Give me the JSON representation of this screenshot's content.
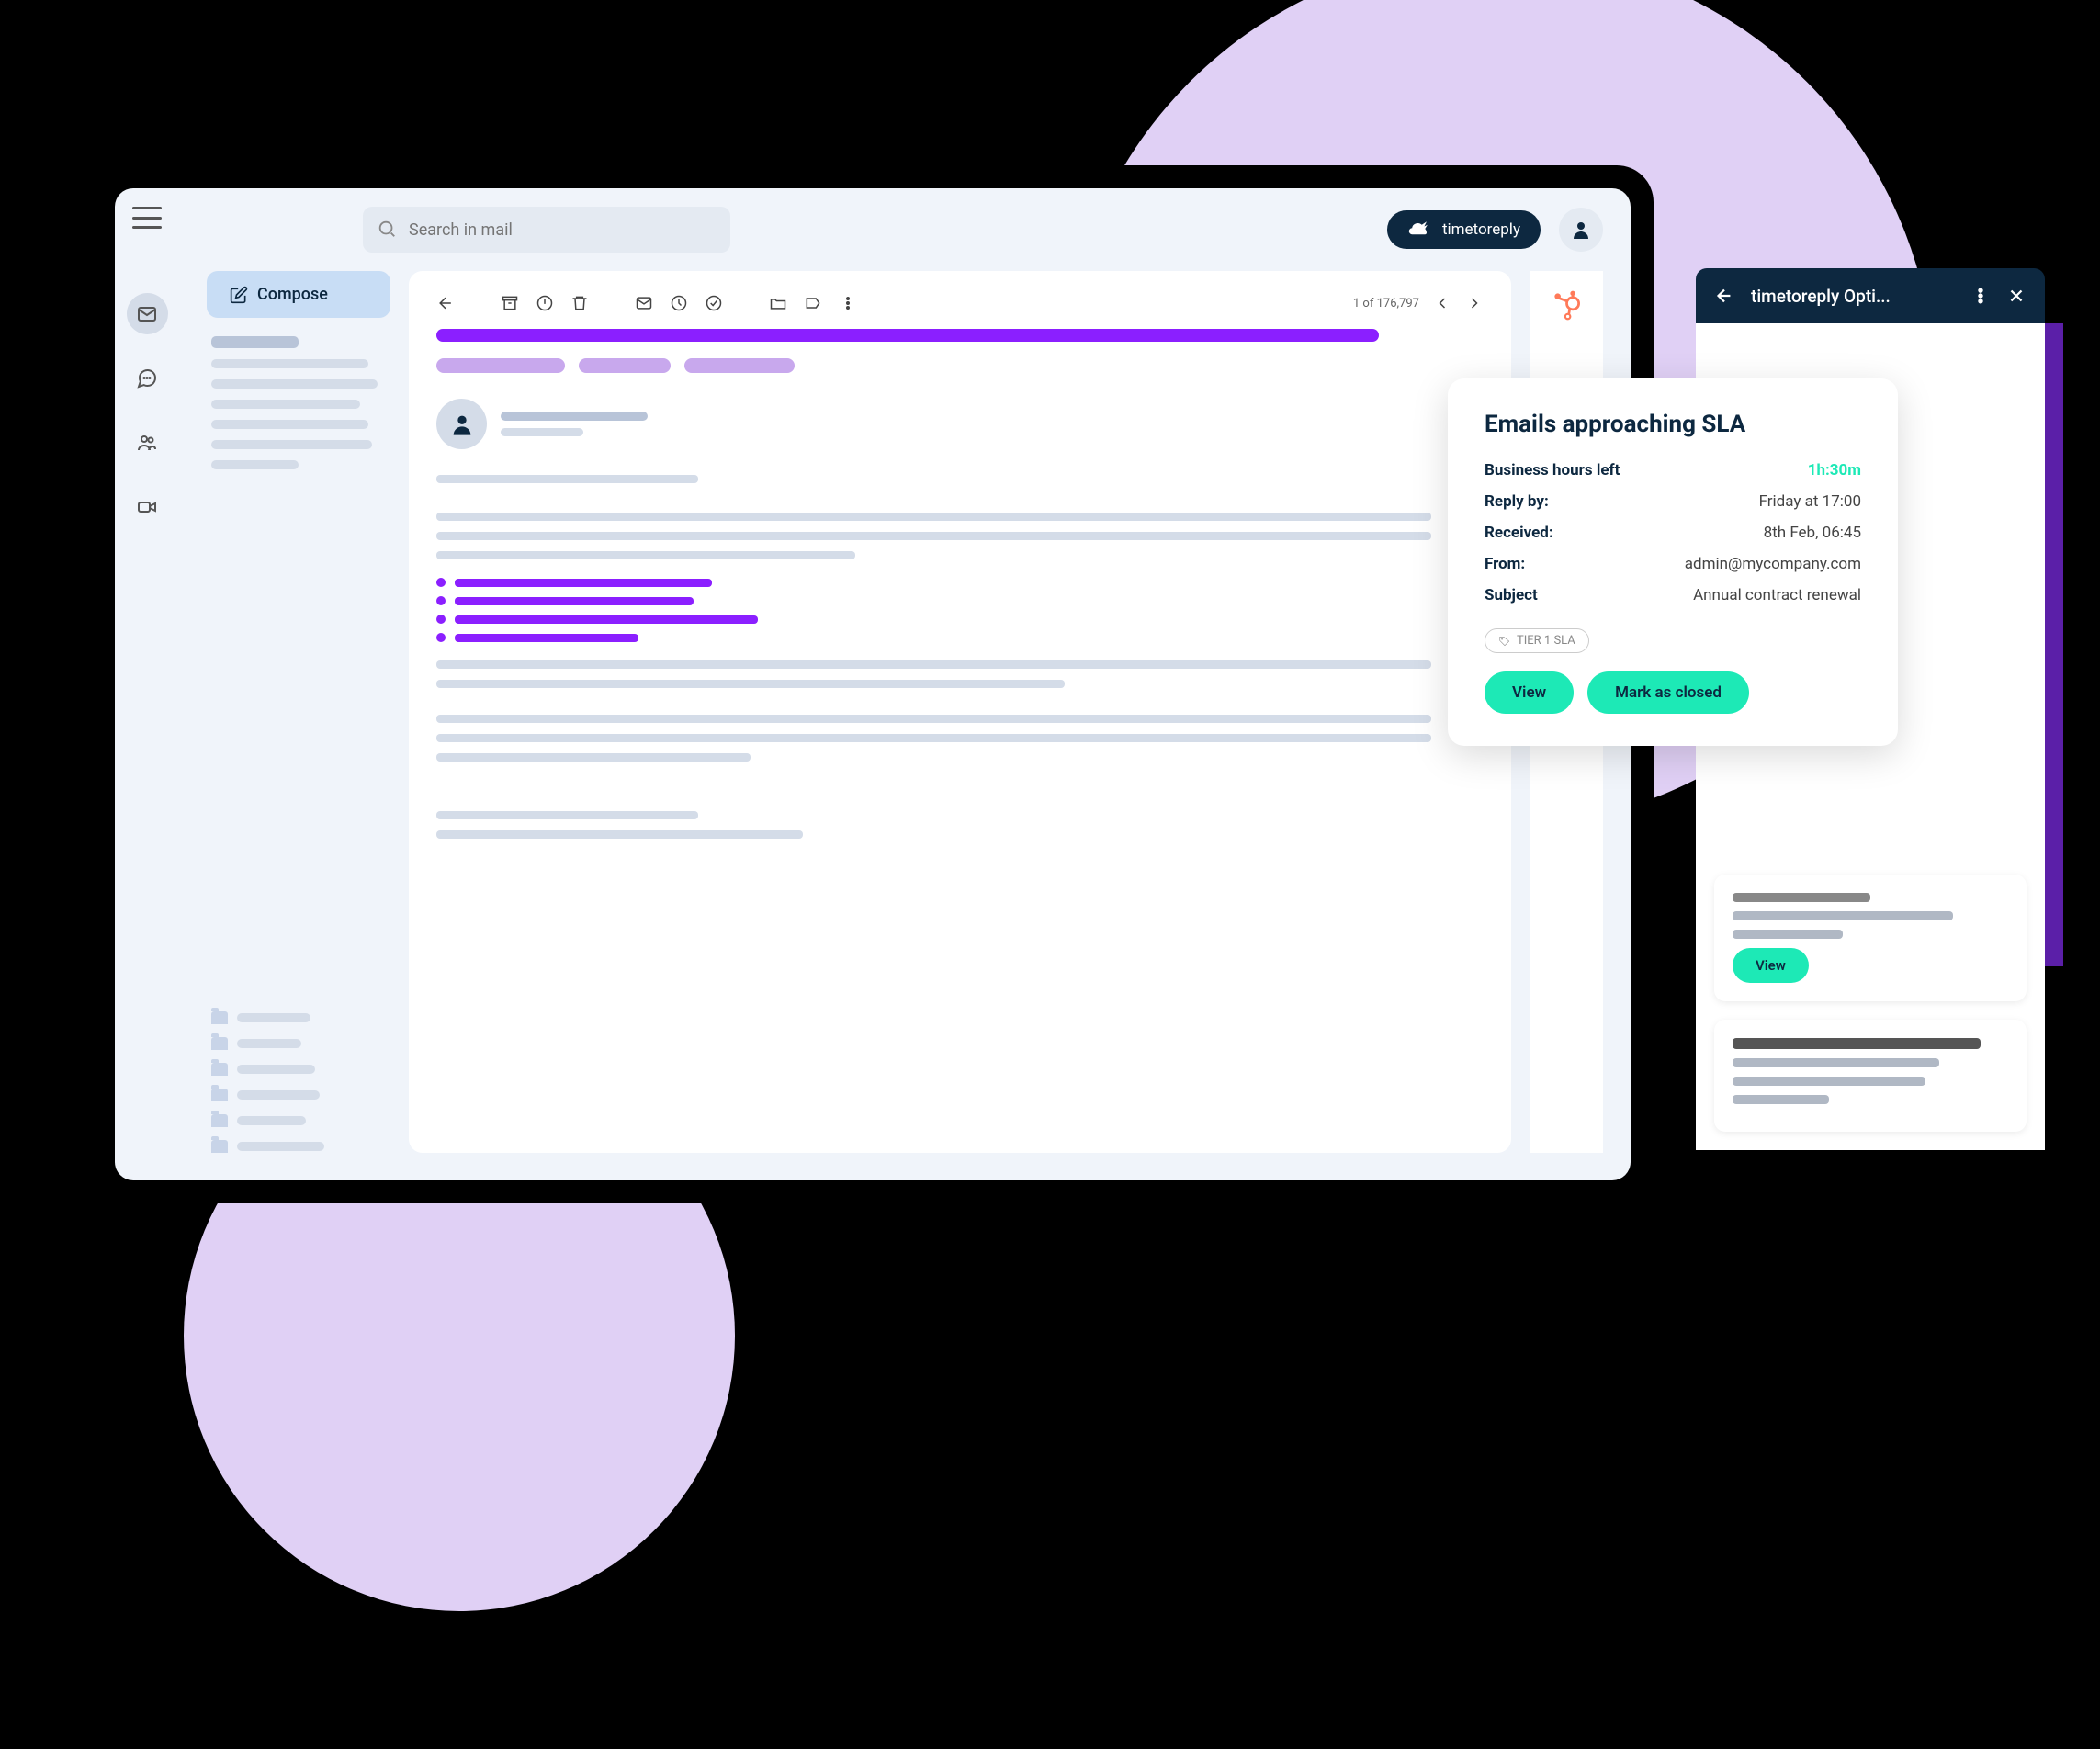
{
  "search": {
    "placeholder": "Search in mail"
  },
  "brand": {
    "name": "timetoreply"
  },
  "compose": {
    "label": "Compose"
  },
  "pagination": {
    "text": "1 of 176,797"
  },
  "panel": {
    "title": "timetoreply Opti..."
  },
  "sla": {
    "title": "Emails approaching SLA",
    "rows": [
      {
        "label": "Business hours left",
        "value": "1h:30m",
        "green": true
      },
      {
        "label": "Reply by:",
        "value": "Friday at 17:00"
      },
      {
        "label": "Received:",
        "value": "8th Feb, 06:45"
      },
      {
        "label": "From:",
        "value": "admin@mycompany.com"
      },
      {
        "label": "Subject",
        "value": "Annual contract renewal"
      }
    ],
    "tag": "TIER 1 SLA",
    "view": "View",
    "close": "Mark as closed"
  },
  "mini": {
    "view": "View"
  }
}
